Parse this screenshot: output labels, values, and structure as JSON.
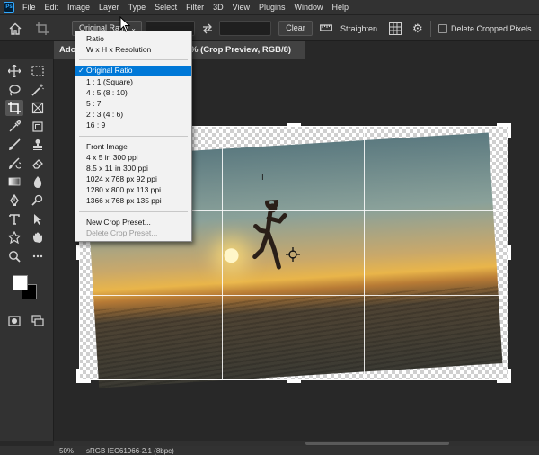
{
  "menubar": {
    "logo": "Ps",
    "items": [
      "File",
      "Edit",
      "Image",
      "Layer",
      "Type",
      "Select",
      "Filter",
      "3D",
      "View",
      "Plugins",
      "Window",
      "Help"
    ]
  },
  "options": {
    "ratio_value": "Original Ratio",
    "clear_label": "Clear",
    "straighten_label": "Straighten",
    "delete_cropped_label": "Delete Cropped Pixels"
  },
  "tab": {
    "title_start": "Ado",
    "title_end": "% (Crop Preview, RGB/8)"
  },
  "dropdown": {
    "group1": [
      "Ratio",
      "W x H x Resolution"
    ],
    "group2": [
      "Original Ratio",
      "1 : 1 (Square)",
      "4 : 5 (8 : 10)",
      "5 : 7",
      "2 : 3 (4 : 6)",
      "16 : 9"
    ],
    "group3": [
      "Front Image",
      "4 x 5 in 300 ppi",
      "8.5 x 11 in 300 ppi",
      "1024 x 768 px 92 ppi",
      "1280 x 800 px 113 ppi",
      "1366 x 768 px 135 ppi"
    ],
    "group4": [
      "New Crop Preset...",
      "Delete Crop Preset..."
    ],
    "selected": "Original Ratio"
  },
  "status": {
    "zoom": "50%",
    "profile": "sRGB IEC61966-2.1 (8bpc)"
  },
  "colors": {
    "accent": "#0078d7",
    "panel": "#323232",
    "canvas_bg": "#282828",
    "foreground_color": "#ffffff",
    "background_color": "#000000"
  }
}
